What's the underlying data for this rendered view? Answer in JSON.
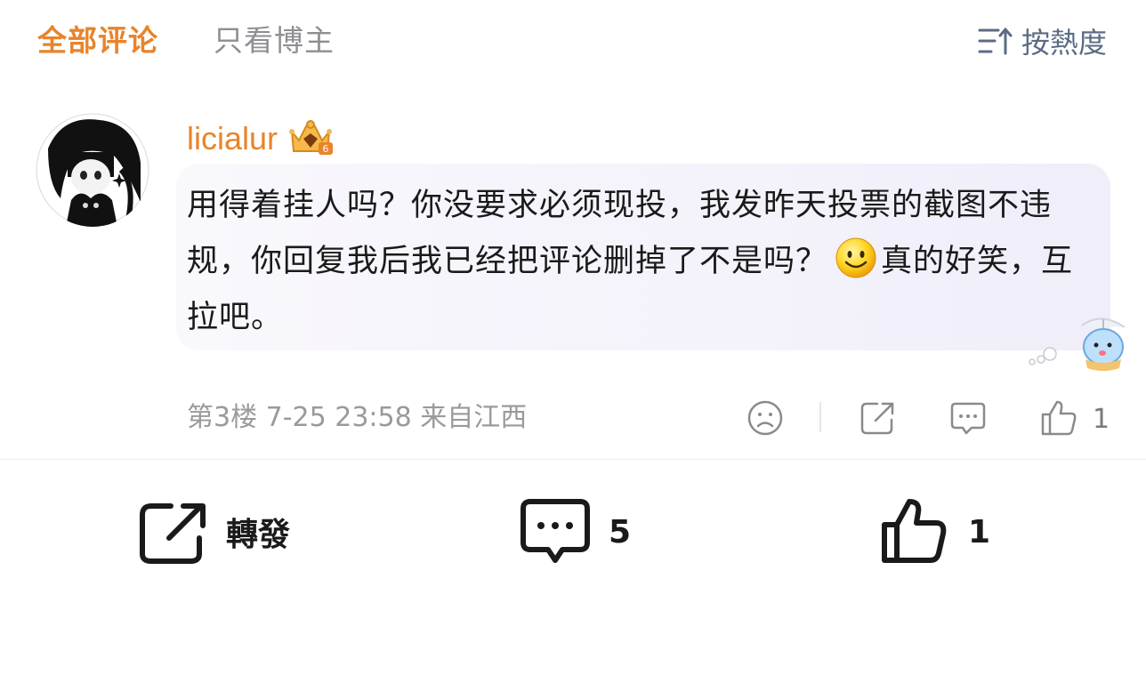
{
  "tabs": {
    "all_comments": "全部评论",
    "only_author": "只看博主"
  },
  "sort": {
    "label": "按熱度",
    "icon": "sort-icon"
  },
  "comment": {
    "username": "licialur",
    "badge_icon": "crown-badge-icon",
    "badge_level": "6",
    "text_part1": "用得着挂人吗？你没要求必须现投，我发昨天投票的截图不违规，你回复我后我已经把评论删掉了不是吗？",
    "emoji_icon": "smiley-emoji-icon",
    "text_part2": "真的好笑，互拉吧。",
    "floor": "第3楼",
    "time": "7-25 23:58",
    "location": "来自江西",
    "like_count": "1"
  },
  "bottom_bar": {
    "repost_label": "轉發",
    "comment_count": "5",
    "like_count": "1"
  },
  "colors": {
    "accent": "#e8842a",
    "muted": "#9a9a9a",
    "bubble": "#f5f3fb"
  }
}
